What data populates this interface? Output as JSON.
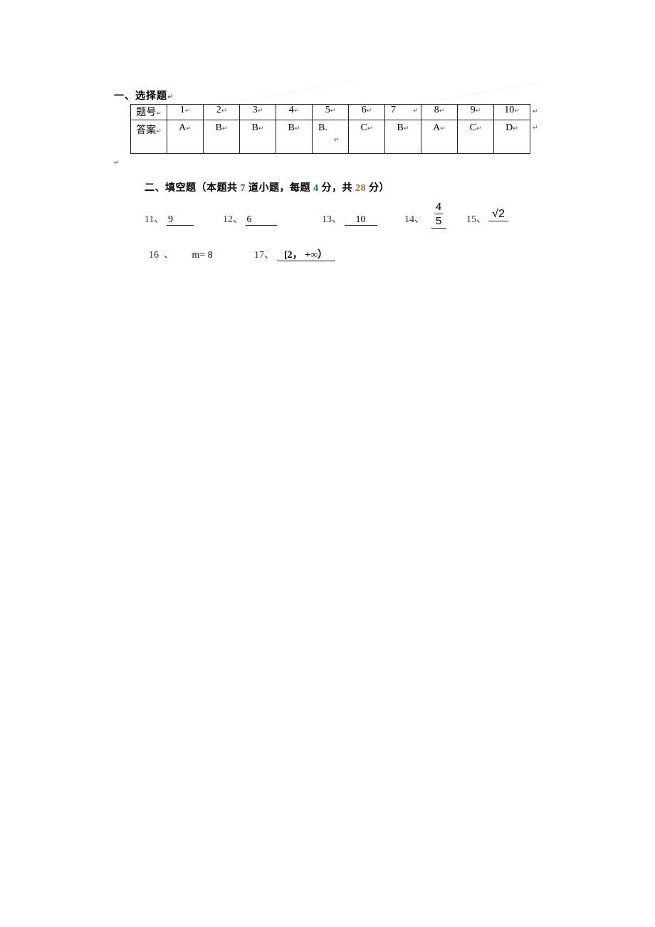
{
  "section1": {
    "title": "一、选择题",
    "table": {
      "row_headers": [
        "题号",
        "答案"
      ],
      "numbers": [
        "1",
        "2",
        "3",
        "4",
        "5",
        "6",
        "7",
        "8",
        "9",
        "10"
      ],
      "answers": [
        "A",
        "B",
        "B",
        "B",
        "B.",
        "C",
        "B",
        "A",
        "C",
        "D"
      ]
    },
    "return_mark": "↵"
  },
  "section2": {
    "title_prefix": "二、填空题（本题共 ",
    "count": "7",
    "title_mid1": " 道小题，每题 ",
    "points_each": "4",
    "title_mid2": " 分，共 ",
    "total_points": "28",
    "title_suffix": " 分）",
    "questions": [
      {
        "num": "11、",
        "answer": "9"
      },
      {
        "num": "12、",
        "answer": "6"
      },
      {
        "num": "13、",
        "answer": "10"
      },
      {
        "num": "14、",
        "numerator": "4",
        "denominator": "5"
      },
      {
        "num": "15、",
        "answer": "√2"
      },
      {
        "num": "16  、",
        "answer": "m= 8"
      },
      {
        "num": "17、",
        "answer": "[2， +∞）"
      }
    ]
  }
}
